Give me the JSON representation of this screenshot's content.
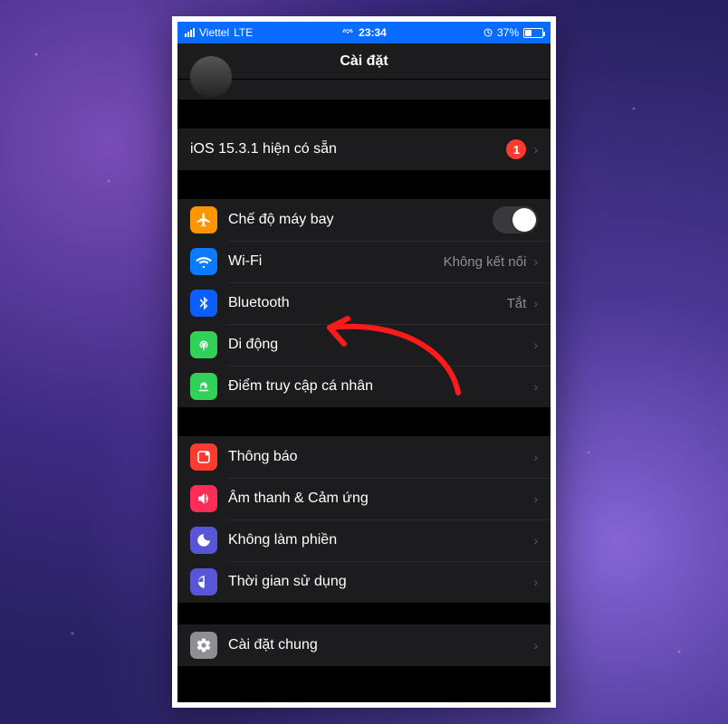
{
  "status": {
    "carrier": "Viettel",
    "network": "LTE",
    "time": "23:34",
    "battery_text": "37%"
  },
  "nav": {
    "title": "Cài đặt"
  },
  "update": {
    "label": "iOS 15.3.1 hiện có sẵn",
    "badge": "1"
  },
  "group_net": {
    "airplane": "Chế độ máy bay",
    "wifi_label": "Wi-Fi",
    "wifi_value": "Không kết nối",
    "bt_label": "Bluetooth",
    "bt_value": "Tắt",
    "cell_label": "Di động",
    "hotspot_label": "Điểm truy cập cá nhân"
  },
  "group_alert": {
    "notif": "Thông báo",
    "sound": "Âm thanh & Cảm ứng",
    "dnd": "Không làm phiền",
    "screen": "Thời gian sử dụng"
  },
  "group_general": {
    "general": "Cài đặt chung"
  }
}
